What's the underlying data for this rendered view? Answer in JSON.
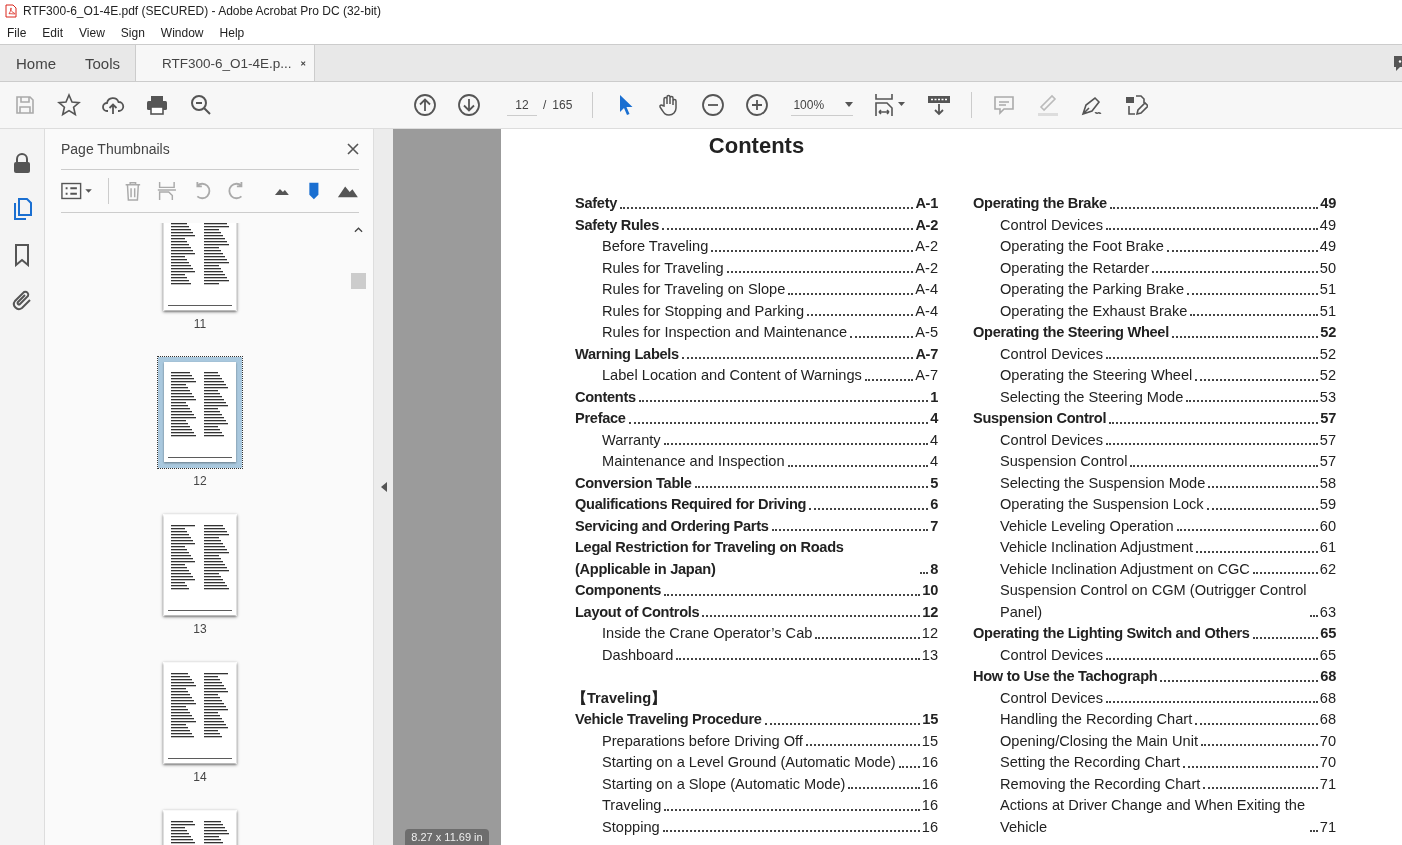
{
  "window": {
    "title": "RTF300-6_O1-4E.pdf (SECURED) - Adobe Acrobat Pro DC (32-bit)"
  },
  "menu": [
    "File",
    "Edit",
    "View",
    "Sign",
    "Window",
    "Help"
  ],
  "tabs": [
    {
      "label": "Home",
      "selected": false,
      "kind": "nav"
    },
    {
      "label": "Tools",
      "selected": false,
      "kind": "nav"
    },
    {
      "label": "RTF300-6_O1-4E.p...",
      "selected": true,
      "kind": "document"
    }
  ],
  "toolbar": {
    "page": "12",
    "page_separator": "/",
    "page_count": "165",
    "zoom": "100%"
  },
  "rail": [
    {
      "selected": false
    },
    {
      "selected": true
    },
    {
      "selected": false
    },
    {
      "selected": false
    }
  ],
  "thumbnails_panel": {
    "title": "Page Thumbnails",
    "pages": [
      {
        "label": "11",
        "selected": false
      },
      {
        "label": "12",
        "selected": true
      },
      {
        "label": "13",
        "selected": false
      },
      {
        "label": "14",
        "selected": false
      },
      {
        "selected": false
      }
    ]
  },
  "page_size": "8.27 x 11.69 in",
  "document": {
    "title": "Contents",
    "columns": [
      [
        {
          "kind": "chapter",
          "text": "Safety",
          "page": "A-1"
        },
        {
          "kind": "chapter",
          "text": "Safety Rules",
          "page": "A-2"
        },
        {
          "kind": "section",
          "text": "Before Traveling",
          "page": "A-2"
        },
        {
          "kind": "section",
          "text": "Rules for Traveling",
          "page": "A-2"
        },
        {
          "kind": "section",
          "text": "Rules for Traveling on Slope",
          "page": "A-4"
        },
        {
          "kind": "section",
          "text": "Rules for Stopping and Parking",
          "page": "A-4"
        },
        {
          "kind": "section",
          "text": "Rules for Inspection and Maintenance",
          "page": "A-5"
        },
        {
          "kind": "chapter",
          "text": "Warning Labels",
          "page": "A-7"
        },
        {
          "kind": "section",
          "text": "Label Location and Content of Warnings",
          "page": "A-7"
        },
        {
          "kind": "chapter",
          "text": "Contents",
          "page": "1"
        },
        {
          "kind": "chapter",
          "text": "Preface",
          "page": "4"
        },
        {
          "kind": "section",
          "text": "Warranty",
          "page": "4"
        },
        {
          "kind": "section",
          "text": "Maintenance and Inspection",
          "page": "4"
        },
        {
          "kind": "chapter",
          "text": "Conversion Table",
          "page": "5"
        },
        {
          "kind": "chapter",
          "text": "Qualifications Required for Driving",
          "page": "6"
        },
        {
          "kind": "chapter",
          "text": "Servicing and Ordering Parts",
          "page": "7"
        },
        {
          "kind": "chapter",
          "text": "Legal Restriction for Traveling on Roads (Applicable in Japan)",
          "page": "8"
        },
        {
          "kind": "chapter",
          "text": "Components",
          "page": "10"
        },
        {
          "kind": "chapter",
          "text": "Layout of Controls",
          "page": "12"
        },
        {
          "kind": "section",
          "text": "Inside the Crane Operator’s Cab",
          "page": "12"
        },
        {
          "kind": "section",
          "text": "Dashboard",
          "page": "13"
        },
        {
          "kind": "gap"
        },
        {
          "kind": "heading",
          "text": "【Traveling】"
        },
        {
          "kind": "chapter",
          "text": "Vehicle Traveling Procedure",
          "page": "15"
        },
        {
          "kind": "section",
          "text": "Preparations before Driving Off",
          "page": "15"
        },
        {
          "kind": "section",
          "text": "Starting on a Level Ground (Automatic Mode)",
          "page": "16"
        },
        {
          "kind": "section",
          "text": "Starting on a Slope (Automatic Mode)",
          "page": "16"
        },
        {
          "kind": "section",
          "text": "Traveling",
          "page": "16"
        },
        {
          "kind": "section",
          "text": "Stopping",
          "page": "16"
        }
      ],
      [
        {
          "kind": "chapter",
          "text": "Operating the Brake",
          "page": "49"
        },
        {
          "kind": "section",
          "text": "Control Devices",
          "page": "49"
        },
        {
          "kind": "section",
          "text": "Operating the Foot Brake",
          "page": "49"
        },
        {
          "kind": "section",
          "text": "Operating the Retarder",
          "page": "50"
        },
        {
          "kind": "section",
          "text": "Operating the Parking Brake",
          "page": "51"
        },
        {
          "kind": "section",
          "text": "Operating the Exhaust Brake",
          "page": "51"
        },
        {
          "kind": "chapter",
          "text": "Operating the Steering Wheel",
          "page": "52"
        },
        {
          "kind": "section",
          "text": "Control Devices",
          "page": "52"
        },
        {
          "kind": "section",
          "text": "Operating the Steering Wheel",
          "page": "52"
        },
        {
          "kind": "section",
          "text": "Selecting the Steering Mode",
          "page": "53"
        },
        {
          "kind": "chapter",
          "text": "Suspension Control",
          "page": "57"
        },
        {
          "kind": "section",
          "text": "Control Devices",
          "page": "57"
        },
        {
          "kind": "section",
          "text": "Suspension Control",
          "page": "57"
        },
        {
          "kind": "section",
          "text": "Selecting the Suspension Mode",
          "page": "58"
        },
        {
          "kind": "section",
          "text": "Operating the Suspension Lock",
          "page": "59"
        },
        {
          "kind": "section",
          "text": "Vehicle Leveling Operation",
          "page": "60"
        },
        {
          "kind": "section",
          "text": "Vehicle Inclination Adjustment",
          "page": "61"
        },
        {
          "kind": "section",
          "text": "Vehicle Inclination Adjustment on CGC",
          "page": "62"
        },
        {
          "kind": "section",
          "text": "Suspension Control on CGM (Outrigger Control Panel)",
          "page": "63"
        },
        {
          "kind": "chapter",
          "text": "Operating the Lighting Switch and Others",
          "page": "65"
        },
        {
          "kind": "section",
          "text": "Control Devices",
          "page": "65"
        },
        {
          "kind": "chapter",
          "text": "How to Use the Tachograph",
          "page": "68"
        },
        {
          "kind": "section",
          "text": "Control Devices",
          "page": "68"
        },
        {
          "kind": "section",
          "text": "Handling the Recording Chart",
          "page": "68"
        },
        {
          "kind": "section",
          "text": "Opening/Closing the Main Unit",
          "page": "70"
        },
        {
          "kind": "section",
          "text": "Setting the Recording Chart",
          "page": "70"
        },
        {
          "kind": "section",
          "text": "Removing the Recording Chart",
          "page": "71"
        },
        {
          "kind": "section",
          "text": "Actions at Driver Change and When Exiting the Vehicle",
          "page": "71"
        }
      ]
    ]
  }
}
